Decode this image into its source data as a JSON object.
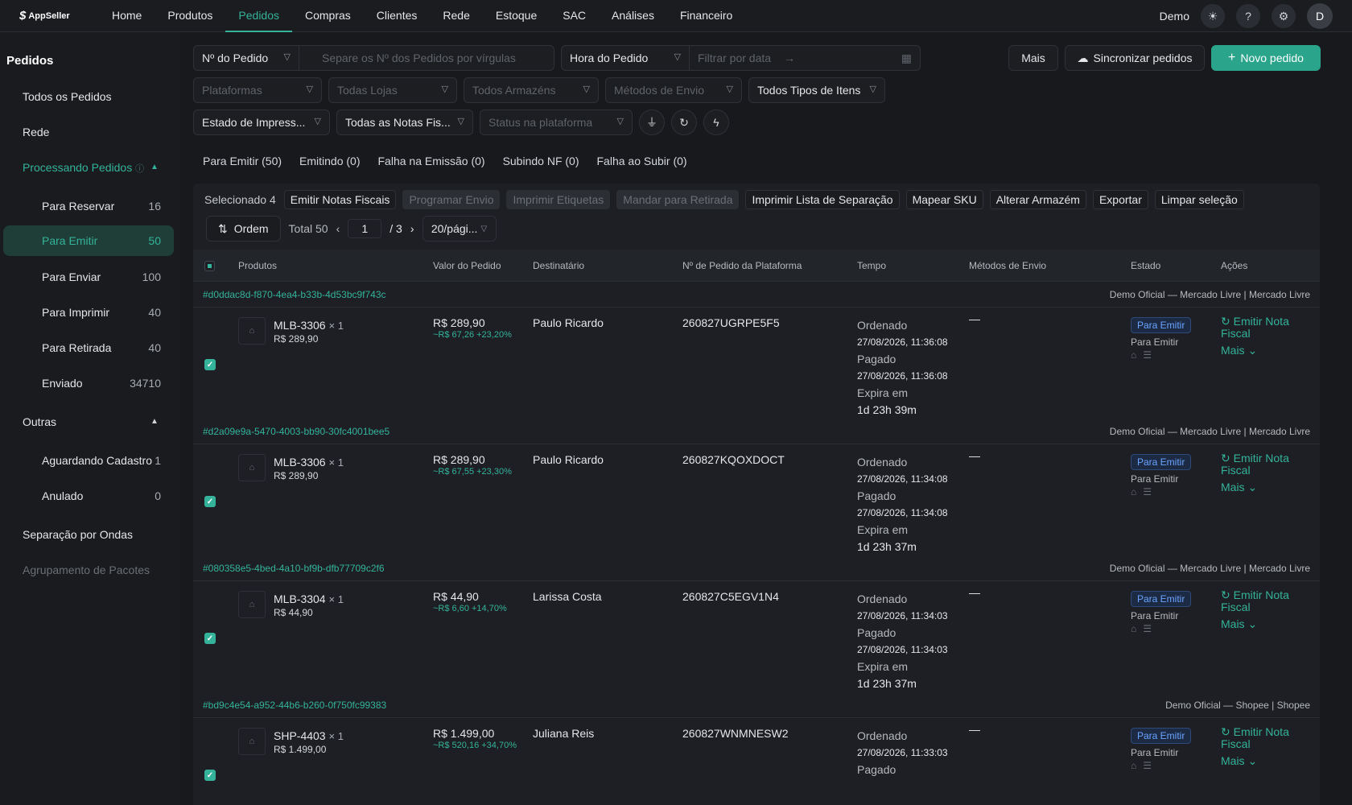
{
  "app": {
    "logo": "AppSeller",
    "user_name": "Demo",
    "avatar_initial": "D"
  },
  "nav": [
    "Home",
    "Produtos",
    "Pedidos",
    "Compras",
    "Clientes",
    "Rede",
    "Estoque",
    "SAC",
    "Análises",
    "Financeiro"
  ],
  "nav_active": "Pedidos",
  "sidebar": {
    "title": "Pedidos",
    "all_orders": "Todos os Pedidos",
    "network": "Rede",
    "processing": "Processando Pedidos",
    "processing_items": [
      {
        "label": "Para Reservar",
        "count": "16"
      },
      {
        "label": "Para Emitir",
        "count": "50"
      },
      {
        "label": "Para Enviar",
        "count": "100"
      },
      {
        "label": "Para Imprimir",
        "count": "40"
      },
      {
        "label": "Para Retirada",
        "count": "40"
      },
      {
        "label": "Enviado",
        "count": "34710"
      }
    ],
    "others": "Outras",
    "other_items": [
      {
        "label": "Aguardando Cadastro",
        "count": "1"
      },
      {
        "label": "Anulado",
        "count": "0"
      }
    ],
    "waves": "Separação por Ondas",
    "grouping": "Agrupamento de Pacotes"
  },
  "filters": {
    "order_no_select": "Nº do Pedido",
    "order_no_placeholder": "Separe os Nº dos Pedidos por vírgulas",
    "time_select": "Hora do Pedido",
    "date_placeholder": "Filtrar por data",
    "platforms": "Plataformas",
    "stores": "Todas Lojas",
    "warehouses": "Todos Armazéns",
    "shipping": "Métodos de Envio",
    "item_types": "Todos Tipos de Itens",
    "print_state": "Estado de Impress...",
    "invoices": "Todas as Notas Fis...",
    "platform_status": "Status na plataforma"
  },
  "buttons": {
    "more": "Mais",
    "sync": "Sincronizar pedidos",
    "new_order": "Novo pedido"
  },
  "subtabs": [
    "Para Emitir (50)",
    "Emitindo (0)",
    "Falha na Emissão (0)",
    "Subindo NF (0)",
    "Falha ao Subir (0)"
  ],
  "actions": {
    "selected": "Selecionado 4",
    "items": [
      {
        "label": "Emitir Notas Fiscais",
        "disabled": false
      },
      {
        "label": "Programar Envio",
        "disabled": true
      },
      {
        "label": "Imprimir Etiquetas",
        "disabled": true
      },
      {
        "label": "Mandar para Retirada",
        "disabled": true
      },
      {
        "label": "Imprimir Lista de Separação",
        "disabled": false
      },
      {
        "label": "Mapear SKU",
        "disabled": false
      },
      {
        "label": "Alterar Armazém",
        "disabled": false
      },
      {
        "label": "Exportar",
        "disabled": false
      },
      {
        "label": "Limpar seleção",
        "disabled": false
      }
    ]
  },
  "pager": {
    "order_btn": "Ordem",
    "total": "Total 50",
    "page": "1",
    "pages": "/ 3",
    "per_page": "20/pági..."
  },
  "columns": [
    "Produtos",
    "Valor do Pedido",
    "Destinatário",
    "Nº de Pedido da Plataforma",
    "Tempo",
    "Métodos de Envio",
    "Estado",
    "Ações"
  ],
  "orders": [
    {
      "id": "#d0ddac8d-f870-4ea4-b33b-4d53bc9f743c",
      "shop": "Demo Oficial — Mercado Livre | Mercado Livre",
      "sku": "MLB-3306",
      "qty": "× 1",
      "sku_price": "R$ 289,90",
      "value": "R$ 289,90",
      "margin": "~R$ 67,26 +23,20%",
      "recipient": "Paulo Ricardo",
      "platform_no": "260827UGRPE5F5",
      "ordered_label": "Ordenado",
      "ordered": "27/08/2026, 11:36:08",
      "paid_label": "Pagado",
      "paid": "27/08/2026, 11:36:08",
      "expires_label": "Expira em",
      "expires": "1d 23h 39m",
      "shipping": "—",
      "badge": "Para Emitir",
      "state": "Para Emitir",
      "action": "Emitir Nota Fiscal",
      "more": "Mais"
    },
    {
      "id": "#d2a09e9a-5470-4003-bb90-30fc4001bee5",
      "shop": "Demo Oficial — Mercado Livre | Mercado Livre",
      "sku": "MLB-3306",
      "qty": "× 1",
      "sku_price": "R$ 289,90",
      "value": "R$ 289,90",
      "margin": "~R$ 67,55 +23,30%",
      "recipient": "Paulo Ricardo",
      "platform_no": "260827KQOXDOCT",
      "ordered_label": "Ordenado",
      "ordered": "27/08/2026, 11:34:08",
      "paid_label": "Pagado",
      "paid": "27/08/2026, 11:34:08",
      "expires_label": "Expira em",
      "expires": "1d 23h 37m",
      "shipping": "—",
      "badge": "Para Emitir",
      "state": "Para Emitir",
      "action": "Emitir Nota Fiscal",
      "more": "Mais"
    },
    {
      "id": "#080358e5-4bed-4a10-bf9b-dfb77709c2f6",
      "shop": "Demo Oficial — Mercado Livre | Mercado Livre",
      "sku": "MLB-3304",
      "qty": "× 1",
      "sku_price": "R$ 44,90",
      "value": "R$ 44,90",
      "margin": "~R$ 6,60 +14,70%",
      "recipient": "Larissa Costa",
      "platform_no": "260827C5EGV1N4",
      "ordered_label": "Ordenado",
      "ordered": "27/08/2026, 11:34:03",
      "paid_label": "Pagado",
      "paid": "27/08/2026, 11:34:03",
      "expires_label": "Expira em",
      "expires": "1d 23h 37m",
      "shipping": "—",
      "badge": "Para Emitir",
      "state": "Para Emitir",
      "action": "Emitir Nota Fiscal",
      "more": "Mais"
    },
    {
      "id": "#bd9c4e54-a952-44b6-b260-0f750fc99383",
      "shop": "Demo Oficial — Shopee | Shopee",
      "sku": "SHP-4403",
      "qty": "× 1",
      "sku_price": "R$ 1.499,00",
      "value": "R$ 1.499,00",
      "margin": "~R$ 520,16 +34,70%",
      "recipient": "Juliana Reis",
      "platform_no": "260827WNMNESW2",
      "ordered_label": "Ordenado",
      "ordered": "27/08/2026, 11:33:03",
      "paid_label": "Pagado",
      "paid": "",
      "expires_label": "",
      "expires": "",
      "shipping": "—",
      "badge": "Para Emitir",
      "state": "Para Emitir",
      "action": "Emitir Nota Fiscal",
      "more": "Mais"
    }
  ],
  "colors": {
    "accent": "#34b39a",
    "primary_button": "#2aa58b",
    "badge_blue": "#6aa4ff"
  }
}
